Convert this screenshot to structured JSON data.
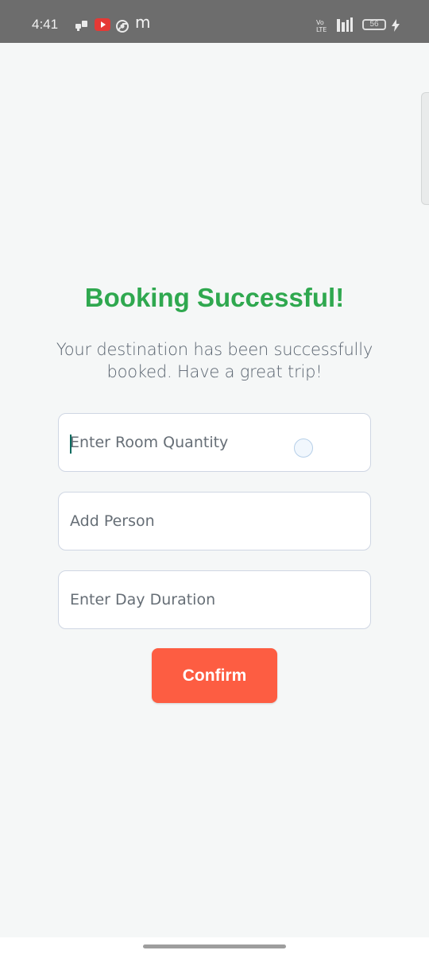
{
  "status_bar": {
    "time": "4:41",
    "battery_level": "56",
    "icons": [
      "chat-notification-icon",
      "youtube-icon",
      "chrome-icon",
      "m-app-icon",
      "volte-icon",
      "signal-icon",
      "battery-icon",
      "charging-icon"
    ],
    "m_glyph": "m"
  },
  "booking": {
    "title": "Booking Successful!",
    "message": "Your destination has been successfully booked. Have a great trip!",
    "title_color": "#2fa84f",
    "accent_color": "#fd5d42"
  },
  "form": {
    "room_quantity": {
      "placeholder": "Enter Room Quantity",
      "value": ""
    },
    "add_person": {
      "placeholder": "Add Person",
      "value": ""
    },
    "day_duration": {
      "placeholder": "Enter Day Duration",
      "value": ""
    },
    "confirm_label": "Confirm"
  }
}
